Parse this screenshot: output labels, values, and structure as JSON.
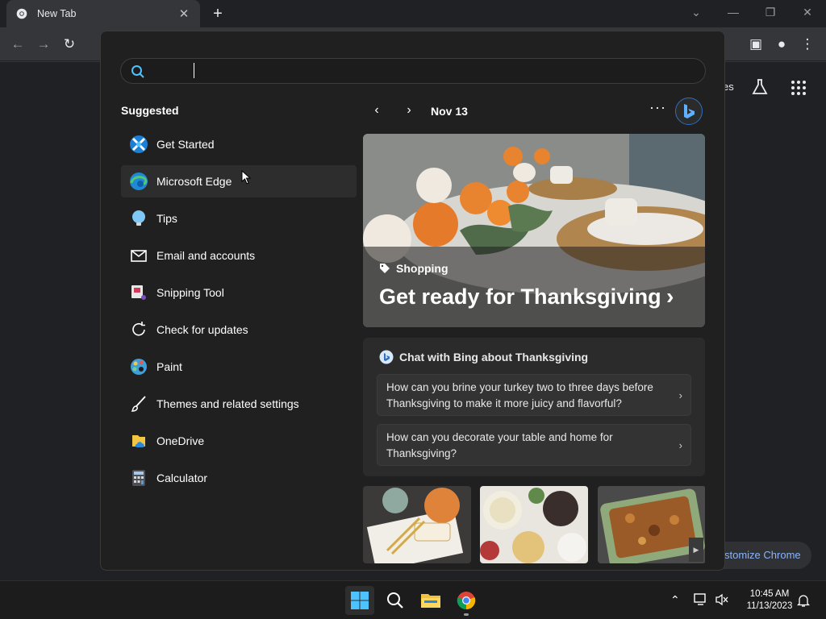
{
  "browser": {
    "tab_title": "New Tab",
    "ntp_right_text": "es",
    "customize_label": "stomize Chrome"
  },
  "start_menu": {
    "search": {
      "value": "",
      "placeholder": ""
    },
    "suggested_heading": "Suggested",
    "apps": [
      {
        "label": "Get Started",
        "icon": "get-started-icon"
      },
      {
        "label": "Microsoft Edge",
        "icon": "edge-icon"
      },
      {
        "label": "Tips",
        "icon": "tips-icon"
      },
      {
        "label": "Email and accounts",
        "icon": "mail-icon"
      },
      {
        "label": "Snipping Tool",
        "icon": "snipping-tool-icon"
      },
      {
        "label": "Check for updates",
        "icon": "refresh-icon"
      },
      {
        "label": "Paint",
        "icon": "paint-icon"
      },
      {
        "label": "Themes and related settings",
        "icon": "brush-icon"
      },
      {
        "label": "OneDrive",
        "icon": "onedrive-icon"
      },
      {
        "label": "Calculator",
        "icon": "calculator-icon"
      }
    ],
    "date": "Nov 13",
    "hero": {
      "category": "Shopping",
      "title": "Get ready for Thanksgiving"
    },
    "chat": {
      "title": "Chat with Bing about Thanksgiving",
      "questions": [
        "How can you brine your turkey two to three days before Thanksgiving to make it more juicy and flavorful?",
        "How can you decorate your table and home for Thanksgiving?"
      ]
    }
  },
  "taskbar": {
    "time": "10:45 AM",
    "date": "11/13/2023"
  },
  "colors": {
    "accent": "#4cc2ff",
    "bing_blue": "#2f6fbb",
    "menu_bg": "#202020"
  }
}
